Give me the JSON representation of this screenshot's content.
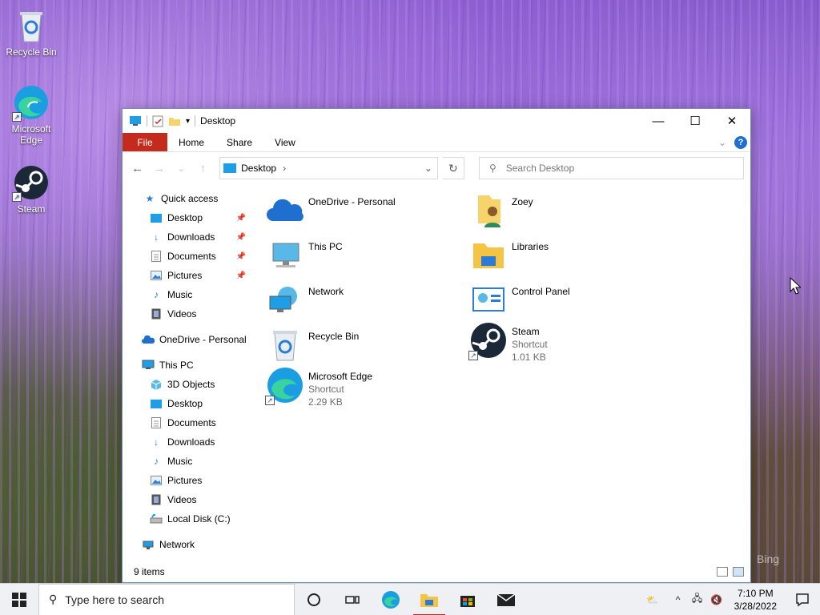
{
  "desktop": {
    "icons": [
      {
        "label": "Recycle Bin",
        "icon": "recycle-bin-icon"
      },
      {
        "label": "Microsoft Edge",
        "icon": "edge-icon"
      },
      {
        "label": "Steam",
        "icon": "steam-icon"
      }
    ],
    "watermark": "Bing"
  },
  "window": {
    "title": "Desktop",
    "controls": {
      "minimize": "—",
      "maximize": "☐",
      "close": "✕"
    },
    "ribbon_tabs": [
      "File",
      "Home",
      "Share",
      "View"
    ],
    "help": "?",
    "address": {
      "current": "Desktop",
      "chevron": "›"
    },
    "search_placeholder": "Search Desktop",
    "nav": {
      "back": "←",
      "forward": "→",
      "recent": "⌄",
      "up": "↑",
      "refresh": "↻"
    }
  },
  "tree": {
    "quick_access": "Quick access",
    "quick_items": [
      {
        "label": "Desktop",
        "pinned": true
      },
      {
        "label": "Downloads",
        "pinned": true
      },
      {
        "label": "Documents",
        "pinned": true
      },
      {
        "label": "Pictures",
        "pinned": true
      },
      {
        "label": "Music",
        "pinned": false
      },
      {
        "label": "Videos",
        "pinned": false
      }
    ],
    "onedrive": "OneDrive - Personal",
    "this_pc": "This PC",
    "pc_items": [
      "3D Objects",
      "Desktop",
      "Documents",
      "Downloads",
      "Music",
      "Pictures",
      "Videos",
      "Local Disk (C:)"
    ],
    "network": "Network"
  },
  "content": {
    "items": [
      {
        "name": "OneDrive - Personal",
        "icon": "onedrive-icon"
      },
      {
        "name": "Zoey",
        "icon": "user-folder-icon"
      },
      {
        "name": "This PC",
        "icon": "this-pc-icon"
      },
      {
        "name": "Libraries",
        "icon": "libraries-icon"
      },
      {
        "name": "Network",
        "icon": "network-icon"
      },
      {
        "name": "Control Panel",
        "icon": "control-panel-icon"
      },
      {
        "name": "Recycle Bin",
        "icon": "recycle-bin-icon"
      },
      {
        "name": "Steam",
        "type": "Shortcut",
        "size": "1.01 KB",
        "icon": "steam-icon"
      },
      {
        "name": "Microsoft Edge",
        "type": "Shortcut",
        "size": "2.29 KB",
        "icon": "edge-icon"
      }
    ]
  },
  "status": {
    "count": "9 items"
  },
  "taskbar": {
    "search_placeholder": "Type here to search",
    "time": "7:10 PM",
    "date": "3/28/2022",
    "tray_chevron": "^"
  },
  "colors": {
    "file_tab": "#c42b1c",
    "accent": "#1f6fd1"
  }
}
